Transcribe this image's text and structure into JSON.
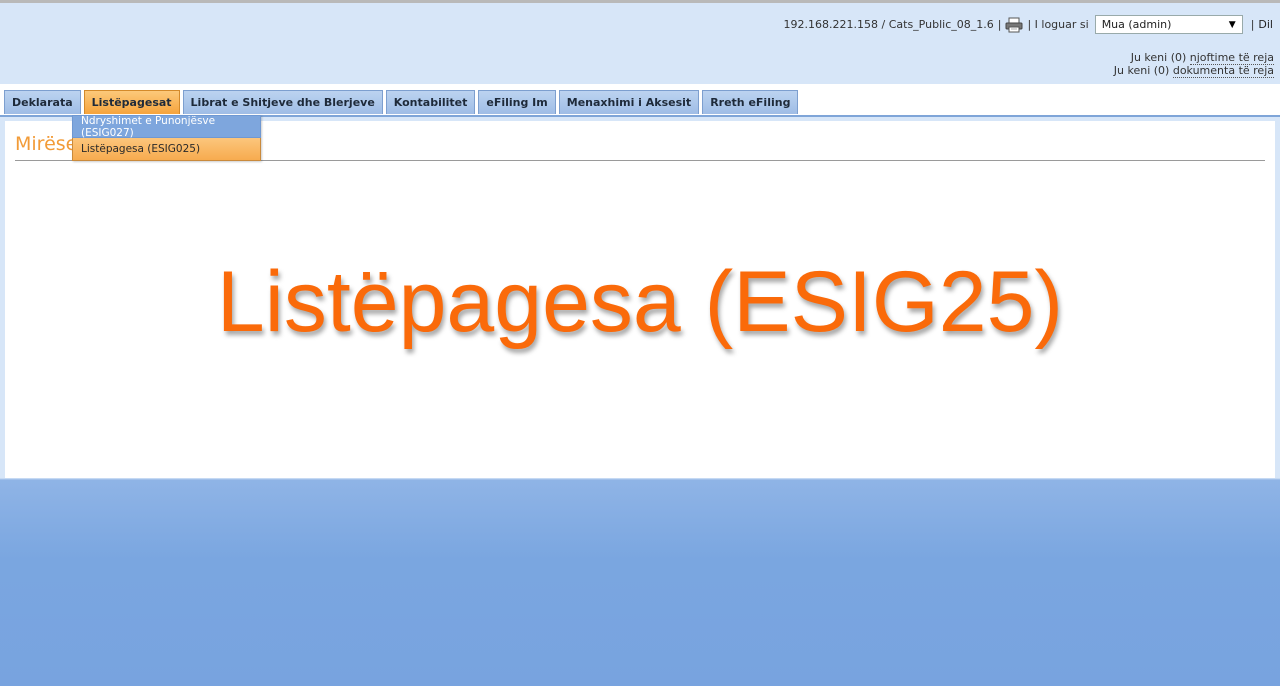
{
  "header": {
    "server_info": "192.168.221.158 / Cats_Public_08_1.6",
    "separator": "|",
    "logged_as_label": "| I loguar si",
    "user_selected": "Mua (admin)",
    "logout_label": "Dil",
    "logout_sep": "|",
    "icons": {
      "print": "printer-icon",
      "dropdown": "triangle-down"
    },
    "notices": {
      "line1_prefix": "Ju keni ",
      "line1_count": "(0)",
      "line1_link": "njoftime të reja",
      "line2_prefix": "Ju keni ",
      "line2_count": "(0)",
      "line2_link": "dokumenta të reja"
    }
  },
  "tabs": [
    {
      "label": "Deklarata",
      "active": false
    },
    {
      "label": "Listëpagesat",
      "active": true
    },
    {
      "label": "Librat e Shitjeve dhe Blerjeve",
      "active": false
    },
    {
      "label": "Kontabilitet",
      "active": false
    },
    {
      "label": "eFiling Im",
      "active": false
    },
    {
      "label": "Menaxhimi i Aksesit",
      "active": false
    },
    {
      "label": "Rreth eFiling",
      "active": false
    }
  ],
  "dropdown": {
    "items": [
      {
        "label": "Ndryshimet e Punonjësve (ESIG027)"
      },
      {
        "label": "Listëpagesa (ESIG025)"
      }
    ]
  },
  "main": {
    "welcome": "Mirëse",
    "banner": "Listëpagesa (ESIG25)"
  },
  "colors": {
    "accent_orange": "#fa6a0a",
    "tab_blue": "#9fbde6",
    "tab_active": "#f6a43d",
    "welcome_orange": "#f29b38"
  }
}
